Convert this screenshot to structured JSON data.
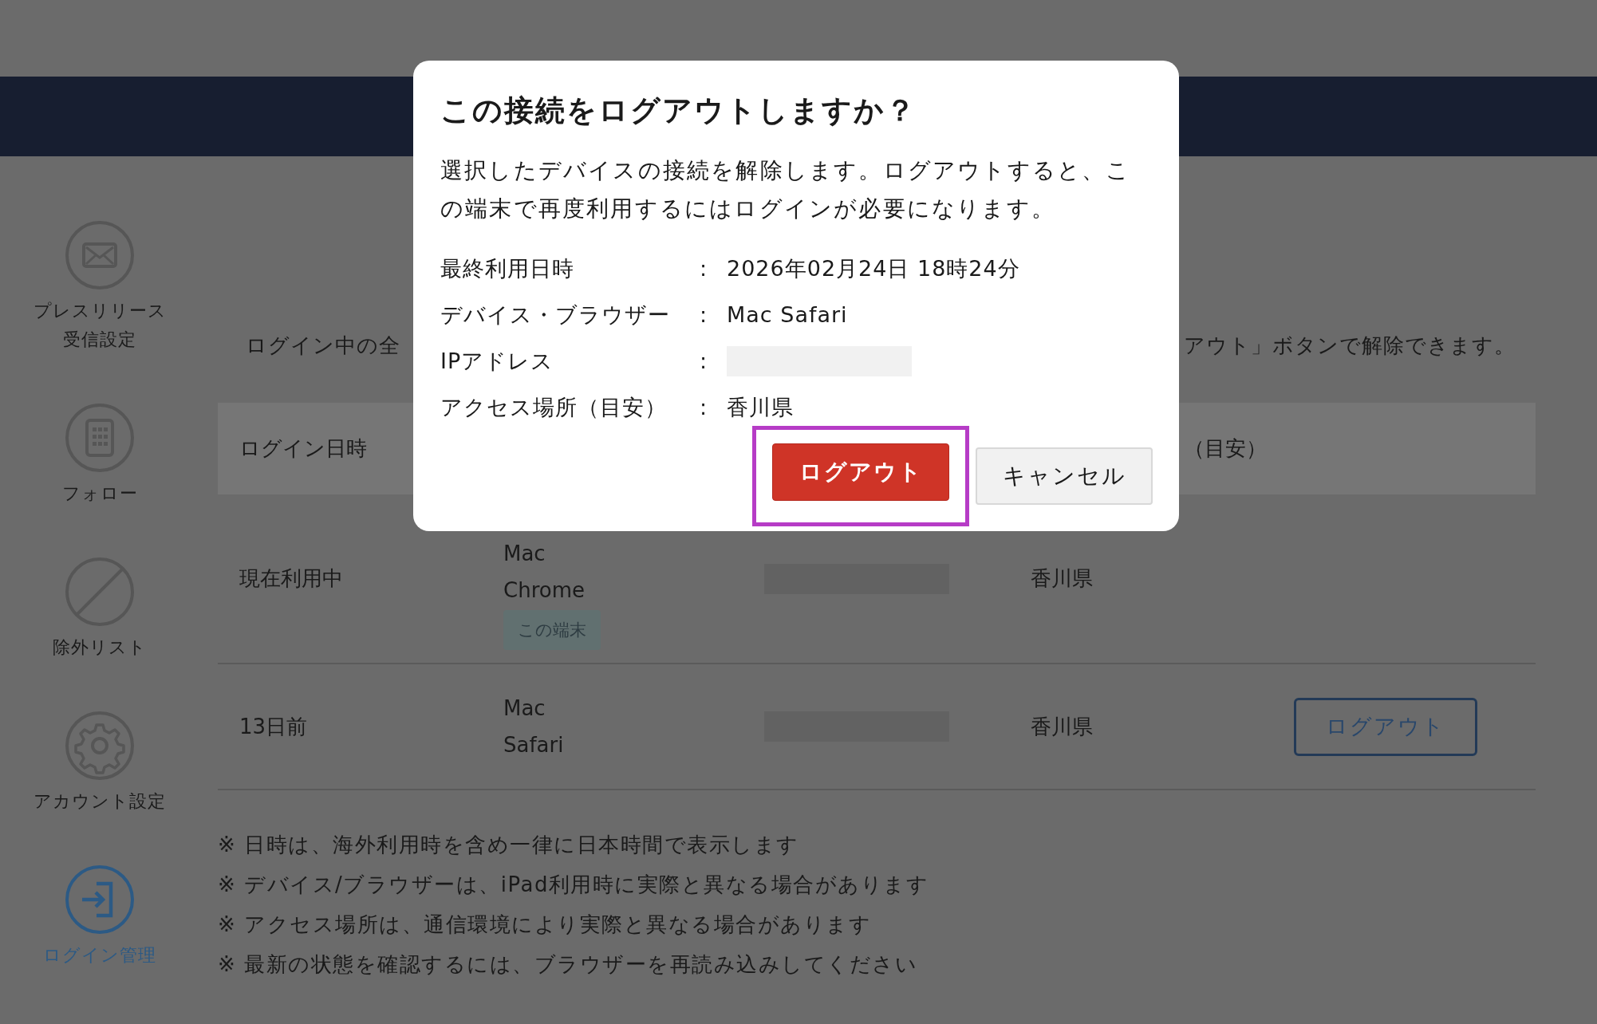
{
  "sidebar": {
    "items": [
      {
        "label_lines": [
          "プレスリリース",
          "受信設定"
        ],
        "selected": false
      },
      {
        "label_lines": [
          "フォロー"
        ],
        "selected": false
      },
      {
        "label_lines": [
          "除外リスト"
        ],
        "selected": false
      },
      {
        "label_lines": [
          "アカウント設定"
        ],
        "selected": false
      },
      {
        "label_lines": [
          "ログイン管理"
        ],
        "selected": true
      }
    ]
  },
  "intro": {
    "left_visible": "ログイン中の全",
    "right_visible": "アウト」ボタンで解除できます。"
  },
  "table": {
    "header_login_time": "ログイン日時",
    "header_location_visible": "（目安）",
    "rows": [
      {
        "login_time": "現在利用中",
        "device": [
          "Mac",
          "Chrome"
        ],
        "tag": "この端末",
        "location": "香川県"
      },
      {
        "login_time": "13日前",
        "device": [
          "Mac",
          "Safari"
        ],
        "location": "香川県",
        "action": "ログアウト"
      }
    ]
  },
  "notes": [
    "※ 日時は、海外利用時を含め一律に日本時間で表示します",
    "※ デバイス/ブラウザーは、iPad利用時に実際と異なる場合があります",
    "※ アクセス場所は、通信環境により実際と異なる場合があります",
    "※ 最新の状態を確認するには、ブラウザーを再読み込みしてください"
  ],
  "dialog": {
    "title": "この接続をログアウトしますか？",
    "message": "選択したデバイスの接続を解除します。ログアウトすると、この端末で再度利用するにはログインが必要になります。",
    "details": [
      {
        "label": "最終利用日時",
        "separator": ":",
        "value": "2026年02月24日 18時24分"
      },
      {
        "label": "デバイス・ブラウザー",
        "separator": ":",
        "value": "Mac Safari"
      },
      {
        "label": "IPアドレス",
        "separator": ":"
      },
      {
        "label": "アクセス場所（目安）",
        "separator": ":",
        "value": "香川県"
      }
    ],
    "buttons": [
      {
        "label": "ログアウト",
        "kind": "primary",
        "highlighted": true
      },
      {
        "label": "キャンセル",
        "kind": "secondary",
        "highlighted": false
      }
    ]
  }
}
